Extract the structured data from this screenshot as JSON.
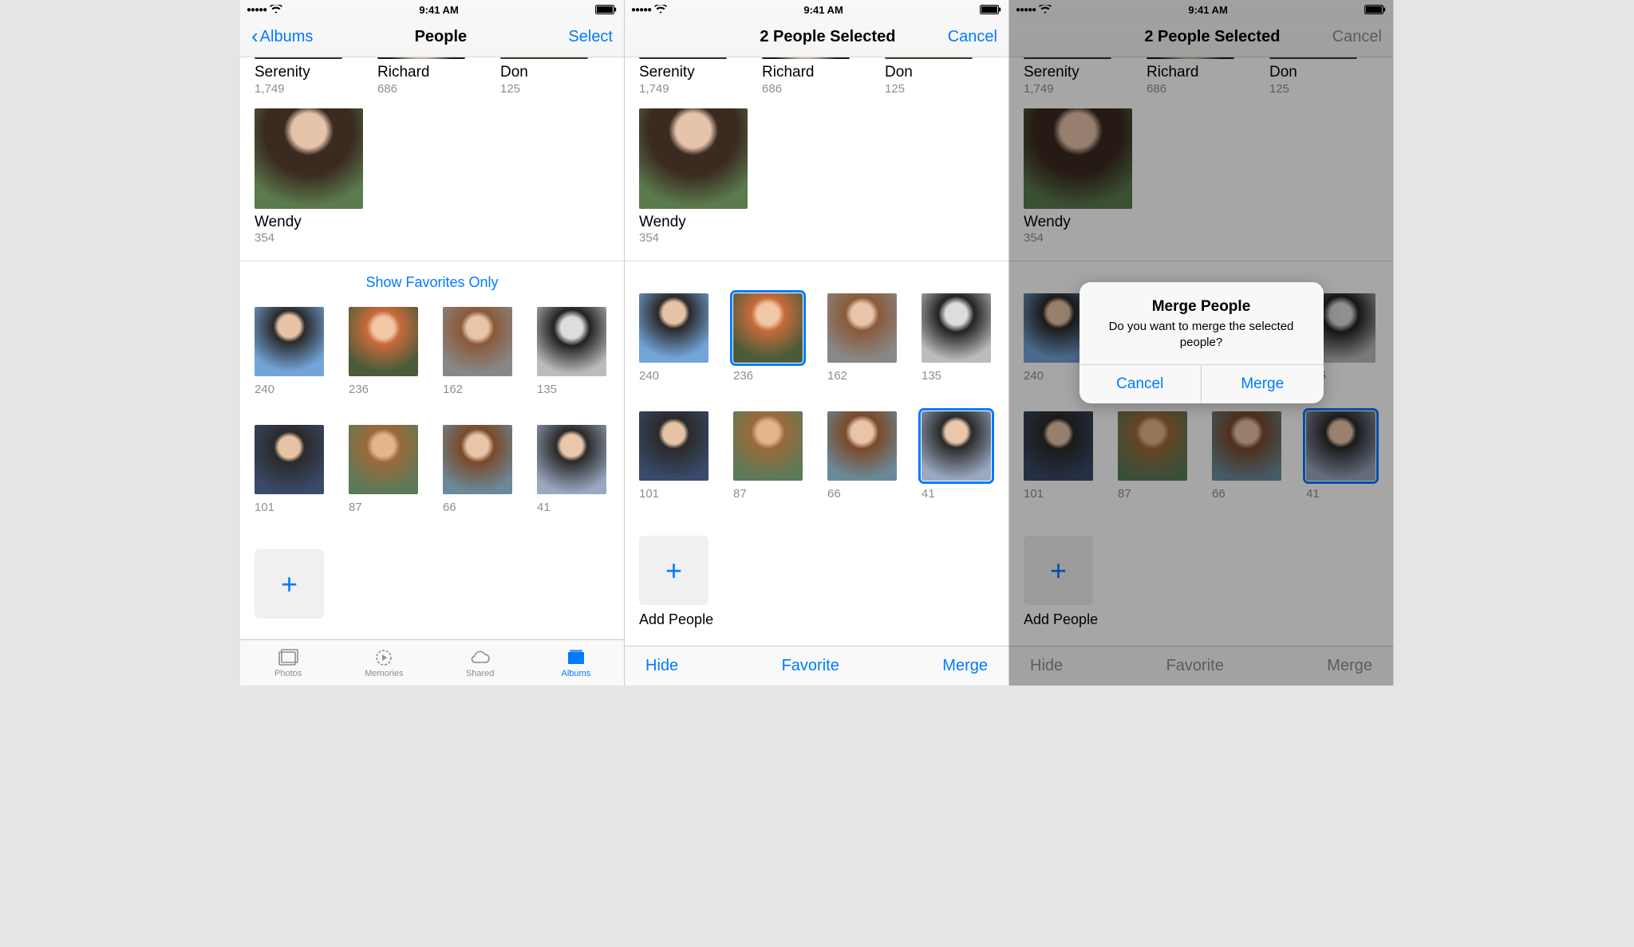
{
  "status": {
    "time": "9:41 AM"
  },
  "screen1": {
    "back_label": "Albums",
    "title": "People",
    "action": "Select",
    "show_favorites": "Show Favorites Only",
    "tabs": {
      "photos": "Photos",
      "memories": "Memories",
      "shared": "Shared",
      "albums": "Albums"
    }
  },
  "screen2": {
    "title": "2 People Selected",
    "action": "Cancel",
    "toolbar": {
      "hide": "Hide",
      "favorite": "Favorite",
      "merge": "Merge"
    },
    "add_label": "Add People"
  },
  "screen3": {
    "title": "2 People Selected",
    "action": "Cancel",
    "toolbar": {
      "hide": "Hide",
      "favorite": "Favorite",
      "merge": "Merge"
    },
    "add_label": "Add People",
    "alert": {
      "title": "Merge People",
      "message": "Do you want to merge the selected people?",
      "cancel": "Cancel",
      "merge": "Merge"
    }
  },
  "named_people": [
    {
      "name": "Serenity",
      "count": "1,749"
    },
    {
      "name": "Richard",
      "count": "686"
    },
    {
      "name": "Don",
      "count": "125"
    }
  ],
  "large_face": {
    "name": "Wendy",
    "count": "354"
  },
  "faces_row1": [
    {
      "count": "240"
    },
    {
      "count": "236"
    },
    {
      "count": "162"
    },
    {
      "count": "135"
    }
  ],
  "faces_row2": [
    {
      "count": "101"
    },
    {
      "count": "87"
    },
    {
      "count": "66"
    },
    {
      "count": "41"
    }
  ],
  "add_label_cut": "Add People"
}
